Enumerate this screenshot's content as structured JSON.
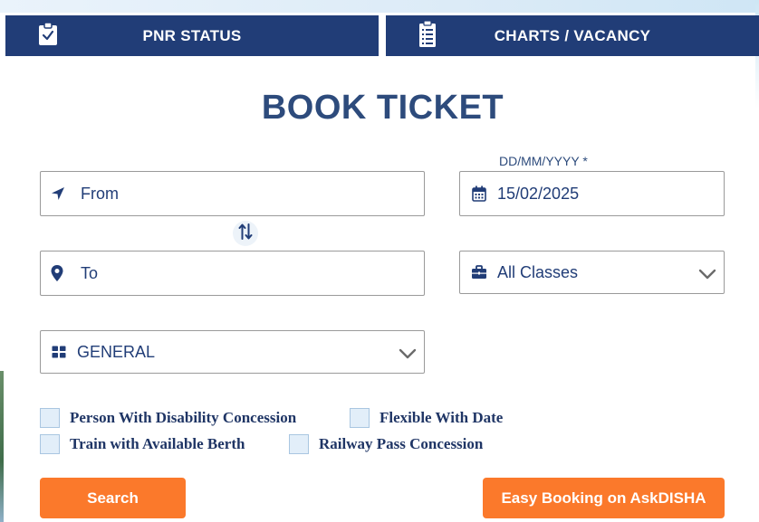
{
  "tabs": {
    "pnr_label": "PNR STATUS",
    "charts_label": "CHARTS / VACANCY"
  },
  "title": "BOOK TICKET",
  "form": {
    "from_placeholder": "From",
    "to_placeholder": "To",
    "date_label": "DD/MM/YYYY *",
    "date_value": "15/02/2025",
    "class_value": "All Classes",
    "quota_value": "GENERAL"
  },
  "checkboxes": {
    "disability": "Person With Disability Concession",
    "flexible": "Flexible With Date",
    "berth": "Train with Available Berth",
    "pass": "Railway Pass Concession"
  },
  "buttons": {
    "search": "Search",
    "disha": "Easy Booking on AskDISHA"
  },
  "icons": {
    "pnr_tab": "clipboard-check-icon",
    "charts_tab": "list-document-icon",
    "from": "location-arrow-icon",
    "to": "map-marker-icon",
    "date": "calendar-icon",
    "class": "briefcase-icon",
    "quota": "grid-icon",
    "swap": "swap-vertical-icon",
    "dropdown": "chevron-down-icon"
  },
  "colors": {
    "navy": "#213d77",
    "title": "#2d4b7c",
    "orange": "#fb792b",
    "checkbox_fill": "#e2eef9"
  }
}
